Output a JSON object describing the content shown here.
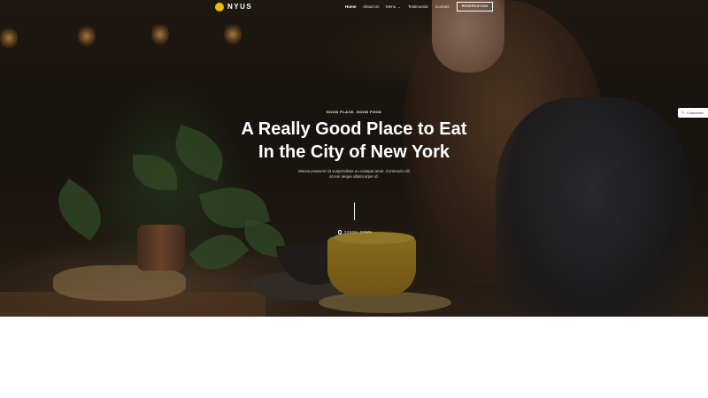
{
  "brand": {
    "name": "NYUS",
    "accent": "#f2b705"
  },
  "nav": {
    "items": [
      {
        "label": "Home",
        "active": true
      },
      {
        "label": "About Us",
        "active": false
      },
      {
        "label": "Menu",
        "active": false,
        "has_dropdown": true
      },
      {
        "label": "Testimonial",
        "active": false
      },
      {
        "label": "Contact",
        "active": false
      }
    ],
    "cta_label": "RESERVATION"
  },
  "hero": {
    "kicker": "GOOD PLACE. GOOD FOOD",
    "title_line1": "A Really Good Place to Eat",
    "title_line2": "In the City of New York",
    "subtitle_line1": "Massa praesent sit suspendisse eu volutpat amet. Commodo elit",
    "subtitle_line2": "at non neque ullamcorper id.",
    "scroll_label": "SCROLL DOWN"
  },
  "customize": {
    "label": "Customize",
    "icon": "pencil-icon"
  }
}
